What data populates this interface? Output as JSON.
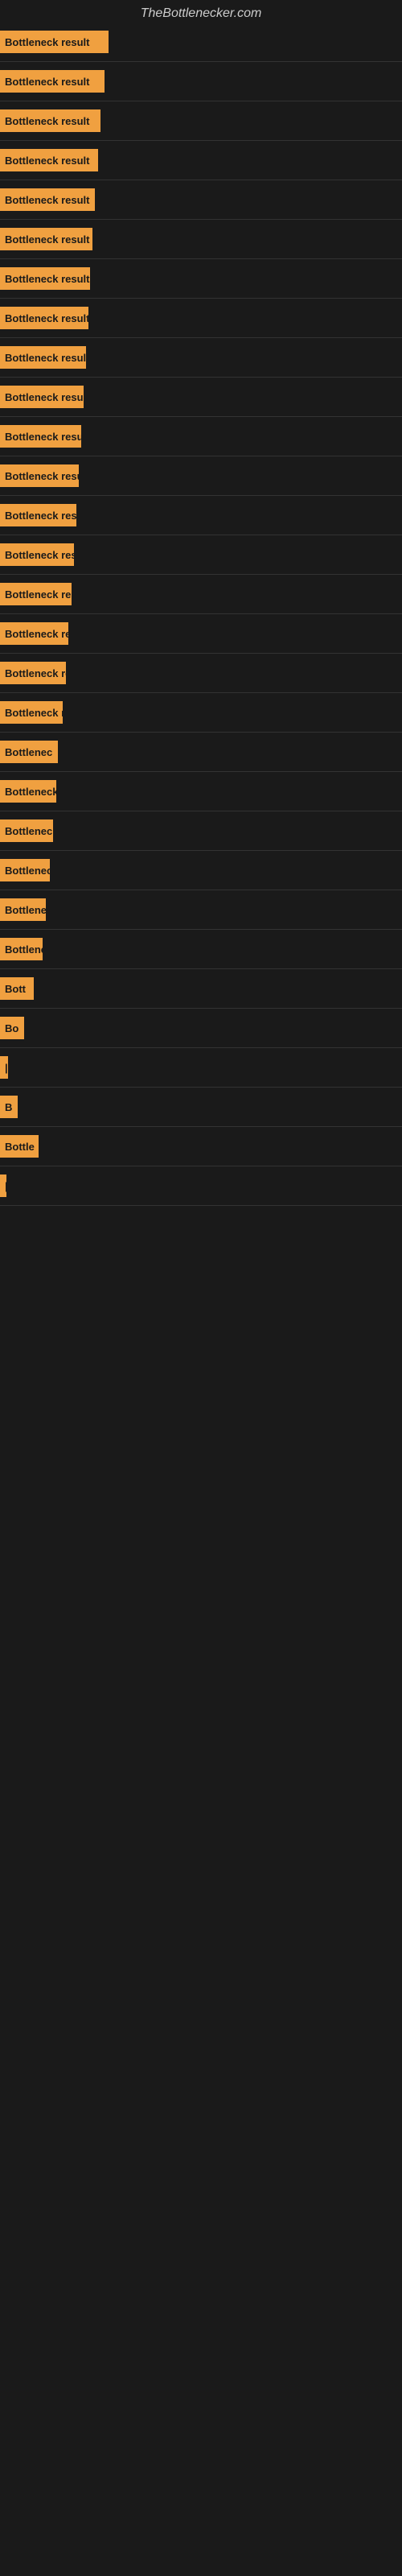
{
  "site": {
    "title": "TheBottlenecker.com"
  },
  "bars": [
    {
      "id": 1,
      "label": "Bottleneck result",
      "width": 135
    },
    {
      "id": 2,
      "label": "Bottleneck result",
      "width": 130
    },
    {
      "id": 3,
      "label": "Bottleneck result",
      "width": 125
    },
    {
      "id": 4,
      "label": "Bottleneck result",
      "width": 122
    },
    {
      "id": 5,
      "label": "Bottleneck result",
      "width": 118
    },
    {
      "id": 6,
      "label": "Bottleneck result",
      "width": 115
    },
    {
      "id": 7,
      "label": "Bottleneck result",
      "width": 112
    },
    {
      "id": 8,
      "label": "Bottleneck result",
      "width": 110
    },
    {
      "id": 9,
      "label": "Bottleneck result",
      "width": 107
    },
    {
      "id": 10,
      "label": "Bottleneck result",
      "width": 104
    },
    {
      "id": 11,
      "label": "Bottleneck result",
      "width": 101
    },
    {
      "id": 12,
      "label": "Bottleneck result",
      "width": 98
    },
    {
      "id": 13,
      "label": "Bottleneck result",
      "width": 95
    },
    {
      "id": 14,
      "label": "Bottleneck result",
      "width": 92
    },
    {
      "id": 15,
      "label": "Bottleneck result",
      "width": 89
    },
    {
      "id": 16,
      "label": "Bottleneck res",
      "width": 85
    },
    {
      "id": 17,
      "label": "Bottleneck result",
      "width": 82
    },
    {
      "id": 18,
      "label": "Bottleneck r",
      "width": 78
    },
    {
      "id": 19,
      "label": "Bottlenec",
      "width": 72
    },
    {
      "id": 20,
      "label": "Bottleneck r",
      "width": 70
    },
    {
      "id": 21,
      "label": "Bottleneck",
      "width": 66
    },
    {
      "id": 22,
      "label": "Bottleneck res",
      "width": 62
    },
    {
      "id": 23,
      "label": "Bottlene",
      "width": 57
    },
    {
      "id": 24,
      "label": "Bottleneck r",
      "width": 53
    },
    {
      "id": 25,
      "label": "Bott",
      "width": 42
    },
    {
      "id": 26,
      "label": "Bo",
      "width": 30
    },
    {
      "id": 27,
      "label": "|",
      "width": 10
    },
    {
      "id": 28,
      "label": "B",
      "width": 22
    },
    {
      "id": 29,
      "label": "Bottle",
      "width": 48
    },
    {
      "id": 30,
      "label": "|",
      "width": 8
    }
  ]
}
